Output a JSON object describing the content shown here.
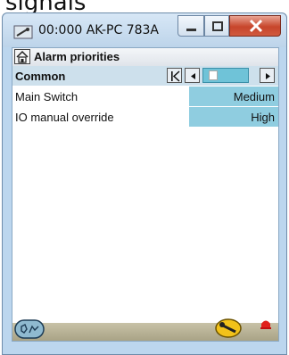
{
  "bg_text": "signals",
  "window": {
    "title": "00:000 AK-PC 783A",
    "minimize_icon": "minimize-icon",
    "maximize_icon": "maximize-icon",
    "close_icon": "close-icon"
  },
  "header": {
    "title": "Alarm priorities",
    "icon": "house-icon"
  },
  "group": {
    "title": "Common"
  },
  "rows": [
    {
      "label": "Main Switch",
      "value": "Medium"
    },
    {
      "label": "IO manual override",
      "value": "High"
    }
  ],
  "footer": {
    "service_icon": "service-tool-icon",
    "wrench_icon": "wrench-icon",
    "alarm_icon": "alarm-bell-icon"
  },
  "colors": {
    "accent": "#8fcde0",
    "slider": "#6fc3d8",
    "close_button": "#c7452b",
    "alarm": "#e0201b"
  }
}
